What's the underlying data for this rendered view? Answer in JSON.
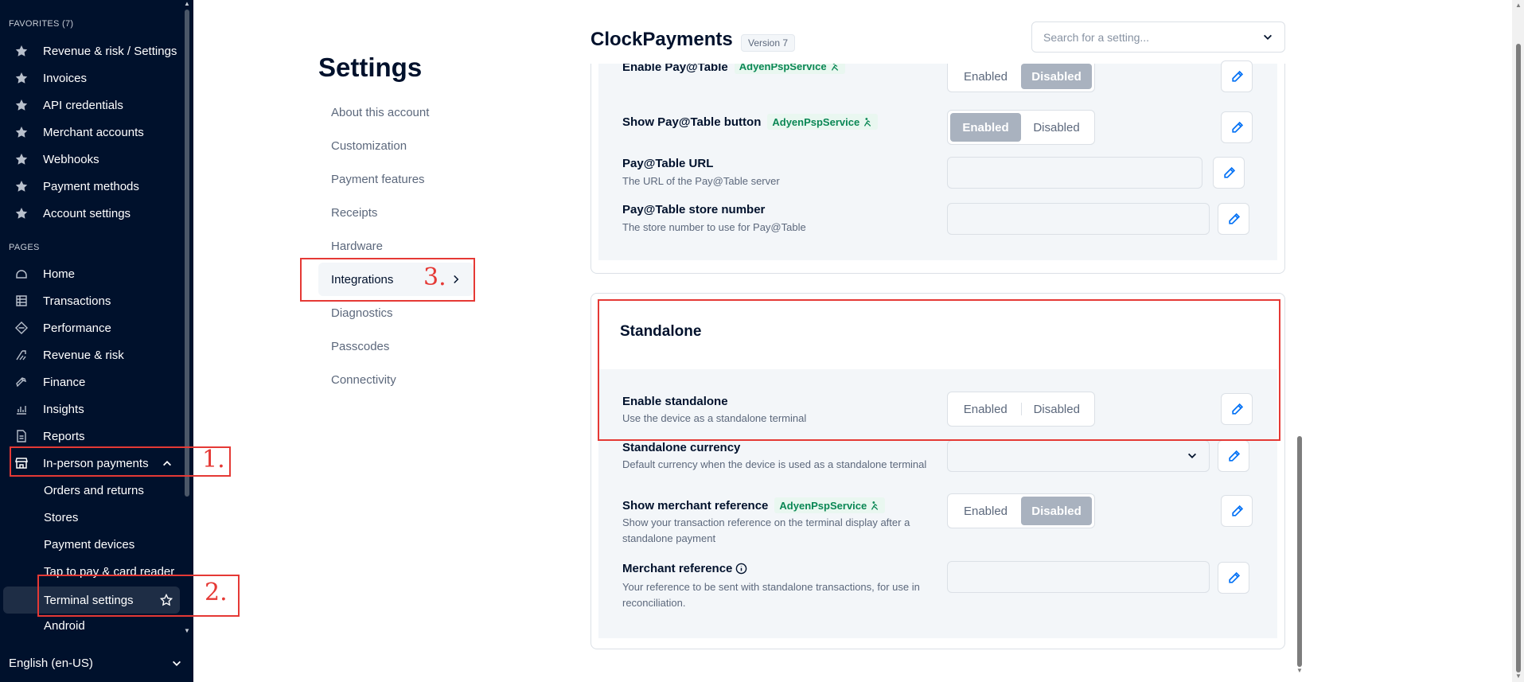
{
  "sidebar": {
    "favorites_header": "FAVORITES (7)",
    "favorites": [
      {
        "label": "Revenue & risk / Settings",
        "icon": "star-icon"
      },
      {
        "label": "Invoices",
        "icon": "star-icon"
      },
      {
        "label": "API credentials",
        "icon": "star-icon"
      },
      {
        "label": "Merchant accounts",
        "icon": "star-icon"
      },
      {
        "label": "Webhooks",
        "icon": "star-icon"
      },
      {
        "label": "Payment methods",
        "icon": "star-icon"
      },
      {
        "label": "Account settings",
        "icon": "star-icon"
      }
    ],
    "pages_header": "PAGES",
    "pages": [
      {
        "label": "Home",
        "icon": "home-icon"
      },
      {
        "label": "Transactions",
        "icon": "table-icon"
      },
      {
        "label": "Performance",
        "icon": "diamond-icon"
      },
      {
        "label": "Revenue & risk",
        "icon": "risk-icon"
      },
      {
        "label": "Finance",
        "icon": "finance-icon"
      },
      {
        "label": "Insights",
        "icon": "bar-chart-icon"
      },
      {
        "label": "Reports",
        "icon": "document-icon"
      },
      {
        "label": "In-person payments",
        "icon": "store-icon"
      }
    ],
    "in_person_sub": [
      "Orders and returns",
      "Stores",
      "Payment devices",
      "Tap to pay & card reader",
      "Terminal settings",
      "Android"
    ],
    "language": "English (en-US)"
  },
  "annotations": {
    "one": "1.",
    "two": "2.",
    "three": "3."
  },
  "settings_nav": {
    "title": "Settings",
    "items": [
      "About this account",
      "Customization",
      "Payment features",
      "Receipts",
      "Hardware",
      "Integrations",
      "Diagnostics",
      "Passcodes",
      "Connectivity"
    ]
  },
  "header": {
    "title": "ClockPayments",
    "version": "Version 7",
    "search_placeholder": "Search for a setting..."
  },
  "toggle_labels": {
    "enabled": "Enabled",
    "disabled": "Disabled"
  },
  "tag_label": "AdyenPspService",
  "pay_at_table": {
    "enable_label": "Enable Pay@Table",
    "show_button_label": "Show Pay@Table button",
    "url_label": "Pay@Table URL",
    "url_desc": "The URL of the Pay@Table server",
    "store_label": "Pay@Table store number",
    "store_desc": "The store number to use for Pay@Table"
  },
  "standalone": {
    "title": "Standalone",
    "enable_label": "Enable standalone",
    "enable_desc": "Use the device as a standalone terminal",
    "currency_label": "Standalone currency",
    "currency_desc": "Default currency when the device is used as a standalone terminal",
    "merchant_ref_label": "Show merchant reference",
    "merchant_ref_desc": "Show your transaction reference on the terminal display after a standalone payment",
    "reference_label": "Merchant reference",
    "reference_desc": "Your reference to be sent with standalone transactions, for use in reconciliation."
  },
  "colors": {
    "sidebar_bg": "#00112c",
    "accent": "#0070f5",
    "annotation": "#e53935",
    "tag_green": "#0a8754"
  }
}
